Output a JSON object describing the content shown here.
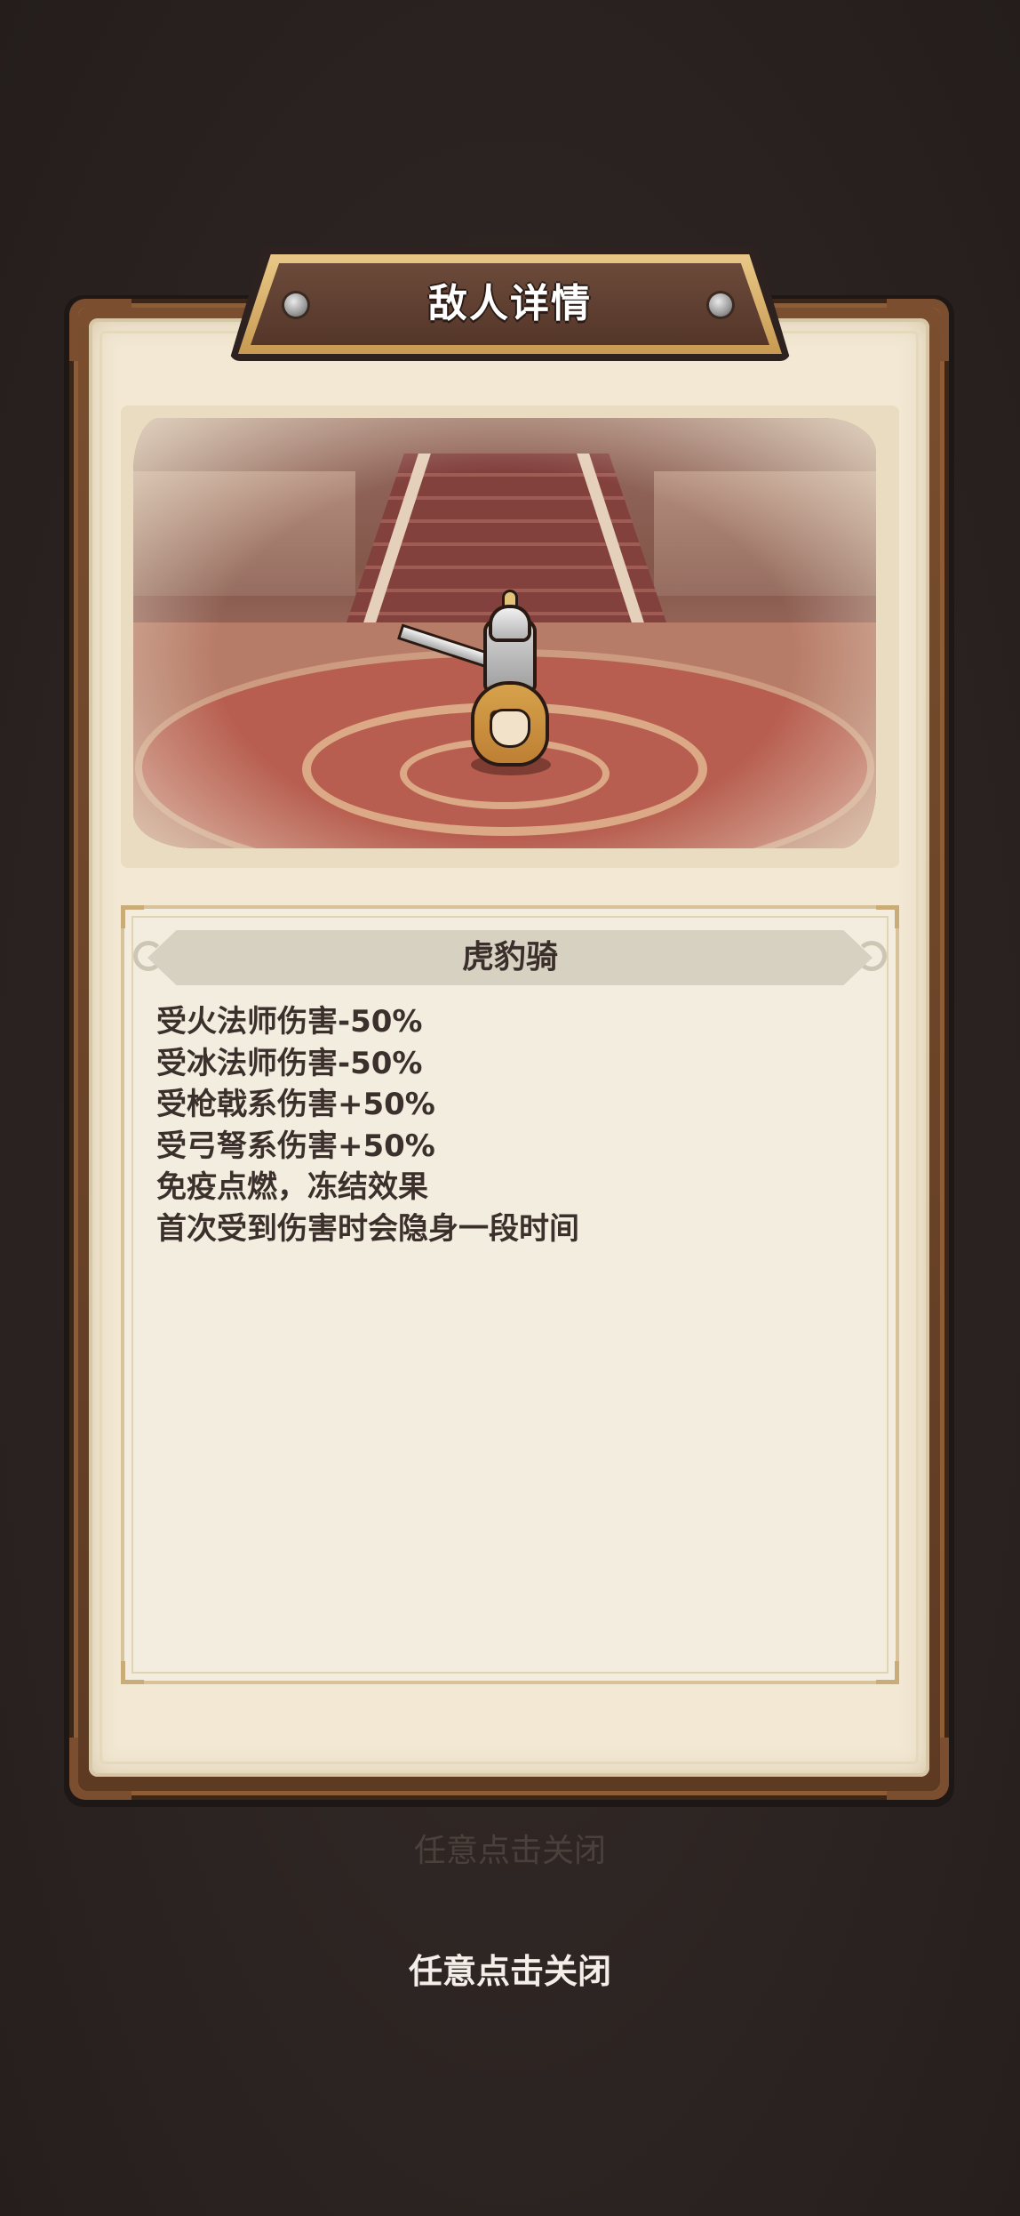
{
  "dialog": {
    "title": "敌人详情"
  },
  "enemy": {
    "name": "虎豹骑",
    "traits": [
      "受火法师伤害-50%",
      "受冰法师伤害-50%",
      "受枪戟系伤害+50%",
      "受弓弩系伤害+50%",
      "免疫点燃，冻结效果",
      "首次受到伤害时会隐身一段时间"
    ]
  },
  "background": {
    "ghost_hint": "任意点击关闭"
  },
  "close_hint": "任意点击关闭",
  "colors": {
    "backdrop": "#2e2624",
    "frame": "#7a4e2f",
    "parchment": "#f2e8d3",
    "text": "#3b302b",
    "title_plate": "#543629"
  }
}
